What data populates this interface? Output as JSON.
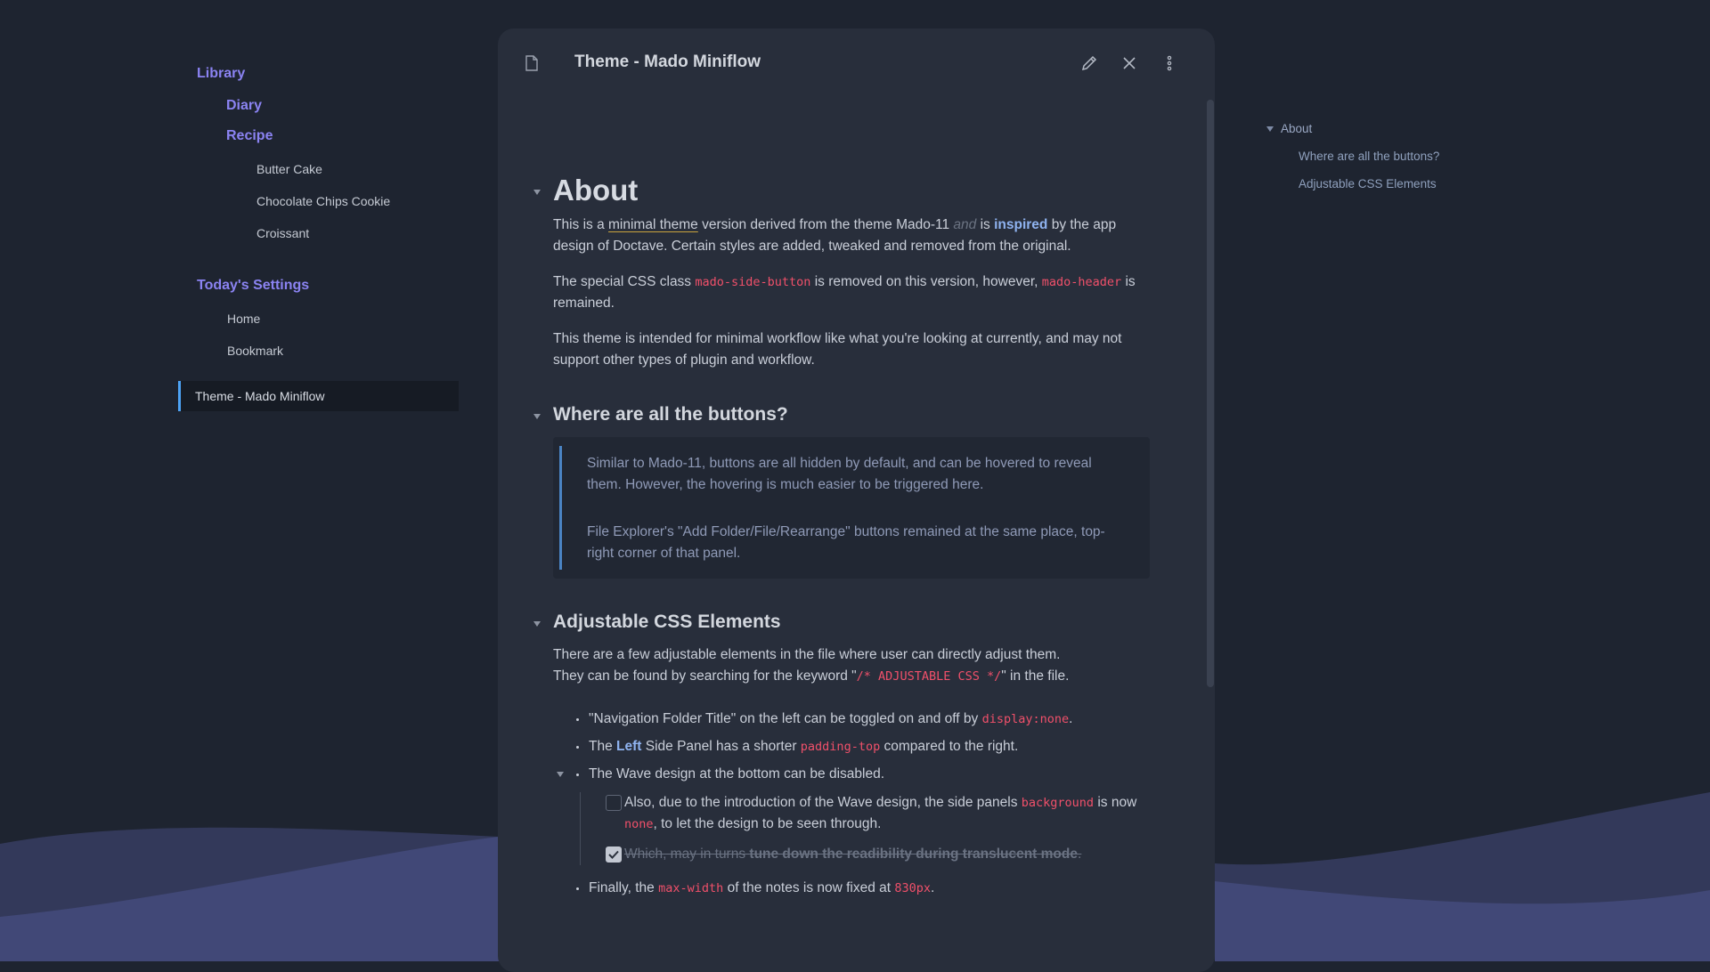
{
  "sidebar": {
    "folder_library": "Library",
    "folder_diary": "Diary",
    "folder_recipe": "Recipe",
    "recipes": [
      "Butter Cake",
      "Chocolate Chips Cookie",
      "Croissant"
    ],
    "folder_today": "Today's Settings",
    "today_items": [
      "Home",
      "Bookmark"
    ],
    "active_file": "Theme - Mado Miniflow"
  },
  "note": {
    "title": "Theme - Mado Miniflow",
    "h1": "About",
    "p1": {
      "a": "This is a ",
      "link": "minimal theme",
      "b": " version derived from the theme Mado-11 ",
      "faint": "and",
      "c": " is ",
      "strong": "inspired",
      "d": " by the app design of Doctave. Certain styles are added, tweaked and removed from the original."
    },
    "p2": {
      "a": "The special CSS class ",
      "code1": "mado-side-button",
      "b": " is removed on this version, however, ",
      "code2": "mado-header",
      "c": " is remained."
    },
    "p3": "This theme is intended for minimal workflow like what you're looking at currently, and may not support other types of plugin and workflow.",
    "h2_buttons": "Where are all the buttons?",
    "quote1": "Similar to Mado-11, buttons are all hidden by default, and can be hovered to reveal them. However, the hovering is much easier to be triggered here.",
    "quote2": "File Explorer's \"Add Folder/File/Rearrange\" buttons remained at the same place, top-right corner of that panel.",
    "h2_css": "Adjustable CSS Elements",
    "p4_line1": "There are a few adjustable elements in the file where user can directly adjust them.",
    "p4_line2a": "They can be found by searching for the keyword \"",
    "p4_code": "/* ADJUSTABLE CSS */",
    "p4_line2b": "\" in the file.",
    "li1": {
      "a": "\"Navigation Folder Title\" on the left can be toggled on and off by ",
      "code": "display:none",
      "b": "."
    },
    "li2": {
      "a": "The ",
      "strong": "Left",
      "b": " Side Panel has a shorter ",
      "code": "padding-top",
      "c": " compared to the right."
    },
    "li3": "The Wave design at the bottom can be disabled.",
    "task1": {
      "a": "Also, due to the introduction of the Wave design, the side panels ",
      "code1": "background",
      "b": " is now ",
      "code2": "none",
      "c": ", to let the design to be seen through.",
      "checked": false
    },
    "task2": {
      "a": "Which, may in turns ",
      "strong": "tune down the readibility during translucent mode",
      "b": ".",
      "checked": true
    },
    "li4": {
      "a": "Finally, the ",
      "code1": "max-width",
      "b": " of the notes is now fixed at ",
      "code2": "830px",
      "c": "."
    }
  },
  "outline": {
    "top": "About",
    "items": [
      "Where are all the buttons?",
      "Adjustable CSS Elements"
    ]
  },
  "colors": {
    "background": "#1e2430",
    "note_bg": "#282e3b",
    "accent_purple": "#8b83f2",
    "code_red": "#f0506a",
    "active_bar": "#4da3f5",
    "wave": "#3d4470"
  },
  "icons": [
    "file-icon",
    "pencil-icon",
    "close-icon",
    "more-vertical-icon",
    "checkmark-icon"
  ]
}
